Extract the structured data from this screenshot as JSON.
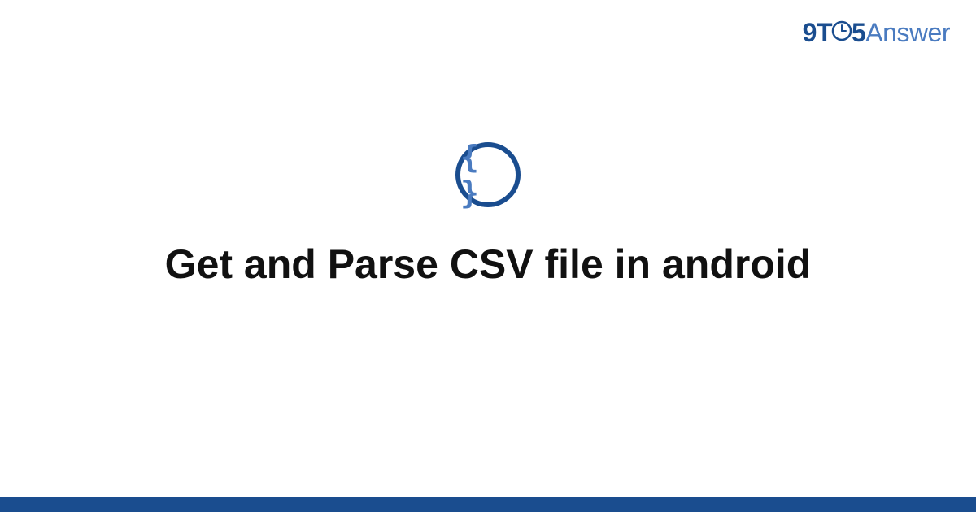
{
  "brand": {
    "part1": "9T",
    "part2": "5",
    "part3": "Answer"
  },
  "icon": {
    "braces": "{ }"
  },
  "title": "Get and Parse CSV file in android",
  "colors": {
    "primary": "#1a4d8f",
    "secondary": "#4a7bc0"
  }
}
